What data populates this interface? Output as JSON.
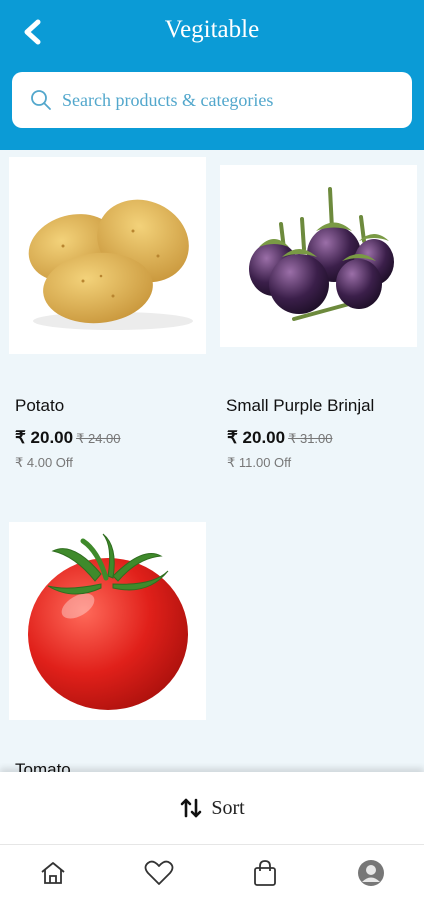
{
  "header": {
    "title": "Vegitable"
  },
  "search": {
    "placeholder": "Search products & categories"
  },
  "products": [
    {
      "name": "Potato",
      "price": "₹ 20.00",
      "mrp": "₹ 24.00",
      "discount": "₹ 4.00 Off"
    },
    {
      "name": "Small Purple Brinjal",
      "price": "₹ 20.00",
      "mrp": "₹ 31.00",
      "discount": "₹ 11.00 Off"
    },
    {
      "name": "Tomato"
    }
  ],
  "sort": {
    "label": "Sort"
  },
  "nav": {
    "items": [
      "home-icon",
      "heart-icon",
      "bag-icon",
      "profile-icon"
    ]
  },
  "colors": {
    "primary": "#0b9bd6",
    "background": "#eef6fa"
  }
}
